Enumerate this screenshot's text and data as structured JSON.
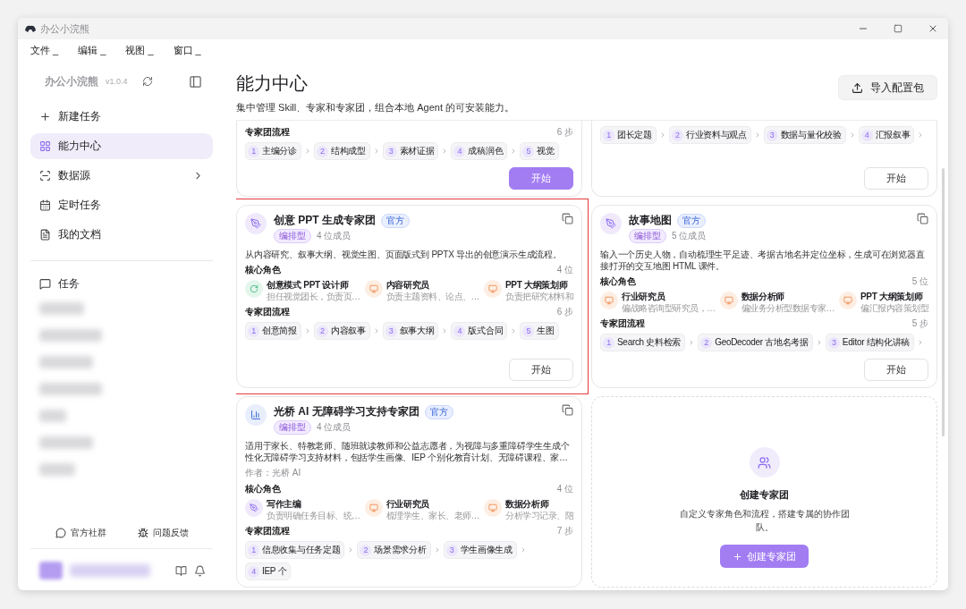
{
  "window": {
    "title": "办公小浣熊"
  },
  "menu": [
    "文件 _",
    "编辑 _",
    "视图 _",
    "窗口 _"
  ],
  "sidebar": {
    "app_name": "办公小浣熊",
    "version": "v1.0.4",
    "nav": [
      {
        "label": "新建任务",
        "kind": "new",
        "selected": false,
        "has_submenu": false
      },
      {
        "label": "能力中心",
        "kind": "apps",
        "selected": true,
        "has_submenu": false
      },
      {
        "label": "数据源",
        "kind": "data",
        "selected": false,
        "has_submenu": true
      },
      {
        "label": "定时任务",
        "kind": "schedule",
        "selected": false,
        "has_submenu": false
      },
      {
        "label": "我的文档",
        "kind": "docs",
        "selected": false,
        "has_submenu": false
      }
    ],
    "tasks_header": "任务",
    "footer_links": [
      {
        "label": "官方社群",
        "kind": "community"
      },
      {
        "label": "问题反馈",
        "kind": "feedback"
      }
    ]
  },
  "page": {
    "title": "能力中心",
    "subtitle": "集中管理 Skill、专家和专家团，组合本地 Agent 的可安装能力。",
    "import_button": "导入配置包"
  },
  "cards": [
    {
      "partial": true,
      "flow_label": "专家团流程",
      "flow_count": "6 步",
      "more_steps": false,
      "steps": [
        {
          "n": "1",
          "label": "主编分诊"
        },
        {
          "n": "2",
          "label": "结构成型"
        },
        {
          "n": "3",
          "label": "素材证据"
        },
        {
          "n": "4",
          "label": "成稿润色"
        },
        {
          "n": "5",
          "label": "视觉"
        }
      ],
      "start_button": {
        "label": "开始",
        "primary": true
      }
    },
    {
      "partial": true,
      "more_steps": true,
      "steps": [
        {
          "n": "1",
          "label": "团长定题"
        },
        {
          "n": "2",
          "label": "行业资料与观点"
        },
        {
          "n": "3",
          "label": "数据与量化校验"
        },
        {
          "n": "4",
          "label": "汇报叙事"
        }
      ],
      "start_button": {
        "label": "开始",
        "primary": false
      }
    },
    {
      "partial": false,
      "highlighted": true,
      "kind": "pen",
      "title": "创意 PPT 生成专家团",
      "badge": "官方",
      "tag": "编排型",
      "members": "4 位成员",
      "description": "从内容研究、叙事大纲、视觉生图、页面版式到 PPTX 导出的创意演示生成流程。",
      "roles_label": "核心角色",
      "roles_count": "4 位",
      "roles": [
        {
          "kind": "cycle",
          "name": "创意模式 PPT 设计师",
          "desc": "担任视觉团长，负责页…"
        },
        {
          "kind": "screen",
          "name": "内容研究员",
          "desc": "负责主题资料、论点、…"
        },
        {
          "kind": "screen",
          "name": "PPT 大纲策划师",
          "desc": "负责把研究材料和"
        }
      ],
      "flow_label": "专家团流程",
      "flow_count": "6 步",
      "more_steps": false,
      "steps": [
        {
          "n": "1",
          "label": "创意简报"
        },
        {
          "n": "2",
          "label": "内容叙事"
        },
        {
          "n": "3",
          "label": "叙事大纲"
        },
        {
          "n": "4",
          "label": "版式合同"
        },
        {
          "n": "5",
          "label": "生图"
        }
      ],
      "start_button": {
        "label": "开始",
        "primary": false
      }
    },
    {
      "partial": false,
      "kind": "pen",
      "title": "故事地图",
      "badge": "官方",
      "tag": "编排型",
      "members": "5 位成员",
      "description": "输入一个历史人物，自动梳理生平足迹、考据古地名并定位坐标，生成可在浏览器直接打开的交互地图 HTML 课件。",
      "roles_label": "核心角色",
      "roles_count": "5 位",
      "roles": [
        {
          "kind": "screen",
          "name": "行业研究员",
          "desc": "偏战略咨询型研究员，…"
        },
        {
          "kind": "screen",
          "name": "数据分析师",
          "desc": "偏业务分析型数据专家…"
        },
        {
          "kind": "screen",
          "name": "PPT 大纲策划师",
          "desc": "偏汇报内容策划型"
        }
      ],
      "flow_label": "专家团流程",
      "flow_count": "5 步",
      "more_steps": true,
      "steps": [
        {
          "n": "1",
          "label": "Search 史料检索"
        },
        {
          "n": "2",
          "label": "GeoDecoder 古地名考据"
        },
        {
          "n": "3",
          "label": "Editor 结构化讲稿"
        }
      ],
      "start_button": {
        "label": "开始",
        "primary": false
      }
    },
    {
      "partial": false,
      "kind": "chart",
      "title": "光桥 AI 无障碍学习支持专家团",
      "badge": "官方",
      "tag": "编排型",
      "members": "4 位成员",
      "description": "适用于家长、特教老师、随班就读教师和公益志愿者，为视障与多重障碍学生生成个性化无障碍学习支持材料，包括学生画像、IEP 个别化教育计划、无障碍课程、家…",
      "author": "作者：光桥 AI",
      "roles_label": "核心角色",
      "roles_count": "4 位",
      "roles": [
        {
          "kind": "pen",
          "name": "写作主编",
          "desc": "负责明确任务目标、统…"
        },
        {
          "kind": "screen",
          "name": "行业研究员",
          "desc": "梳理学生、家长、老师…"
        },
        {
          "kind": "screen",
          "name": "数据分析师",
          "desc": "分析学习记录、陪"
        }
      ],
      "flow_label": "专家团流程",
      "flow_count": "7 步",
      "more_steps": false,
      "steps": [
        {
          "n": "1",
          "label": "信息收集与任务定题"
        },
        {
          "n": "2",
          "label": "场景需求分析"
        },
        {
          "n": "3",
          "label": "学生画像生成"
        },
        {
          "n": "4",
          "label": "IEP 个"
        }
      ]
    }
  ],
  "create_card": {
    "title": "创建专家团",
    "description": "自定义专家角色和流程，搭建专属的协作团队。",
    "button": "创建专家团"
  }
}
